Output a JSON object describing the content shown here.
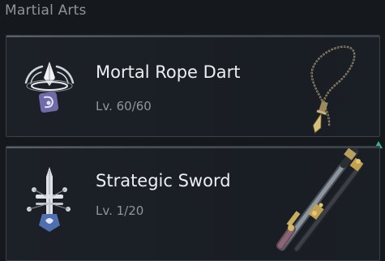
{
  "section": {
    "title": "Martial Arts"
  },
  "arts": [
    {
      "name": "Mortal Rope Dart",
      "level": "Lv. 60/60",
      "icon": "rope-dart-style-icon",
      "weapon": "rope-dart-icon"
    },
    {
      "name": "Strategic Sword",
      "level": "Lv. 1/20",
      "icon": "sword-style-icon",
      "weapon": "sword-icon"
    }
  ],
  "indicators": {
    "upgrade_arrow_color": "#3fae8a"
  },
  "colors": {
    "background": "#15191e",
    "card": "#1c2127",
    "border": "#3b4149",
    "name_text": "#eceff2",
    "level_text": "#8f959c"
  }
}
